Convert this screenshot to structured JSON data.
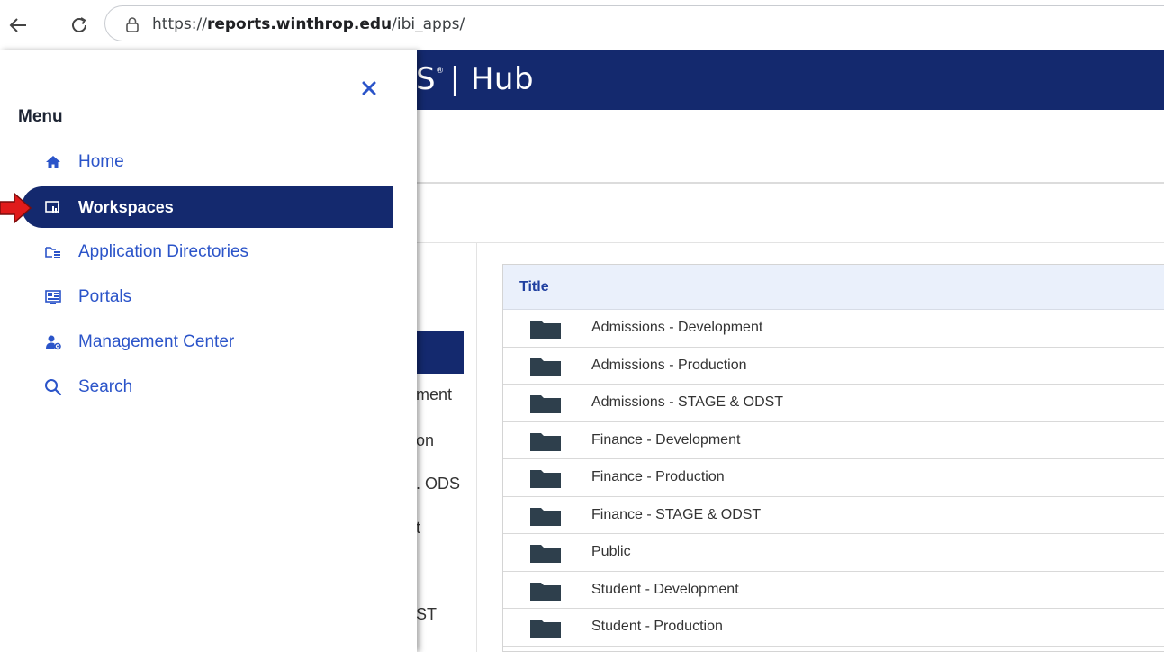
{
  "browser": {
    "url_prefix": "https://",
    "url_host": "reports.winthrop.edu",
    "url_path": "/ibi_apps/"
  },
  "header": {
    "brand_partial": "S",
    "brand_rest": "| Hub"
  },
  "menu": {
    "title": "Menu",
    "items": [
      {
        "label": "Home",
        "icon": "home-icon"
      },
      {
        "label": "Workspaces",
        "icon": "workspaces-icon",
        "active": true
      },
      {
        "label": "Application Directories",
        "icon": "app-directories-icon"
      },
      {
        "label": "Portals",
        "icon": "portals-icon"
      },
      {
        "label": "Management Center",
        "icon": "management-center-icon"
      },
      {
        "label": "Search",
        "icon": "search-icon"
      }
    ]
  },
  "tree_fragments": [
    "ment",
    "on",
    ". ODS",
    "t",
    "ST"
  ],
  "table": {
    "header": "Title",
    "rows": [
      "Admissions - Development",
      "Admissions - Production",
      "Admissions - STAGE & ODST",
      "Finance - Development",
      "Finance - Production",
      "Finance - STAGE & ODST",
      "Public",
      "Student - Development",
      "Student - Production"
    ]
  },
  "colors": {
    "header_bg": "#14296e",
    "menu_link": "#2b54c9",
    "annotation_arrow": "#e01b1b"
  }
}
